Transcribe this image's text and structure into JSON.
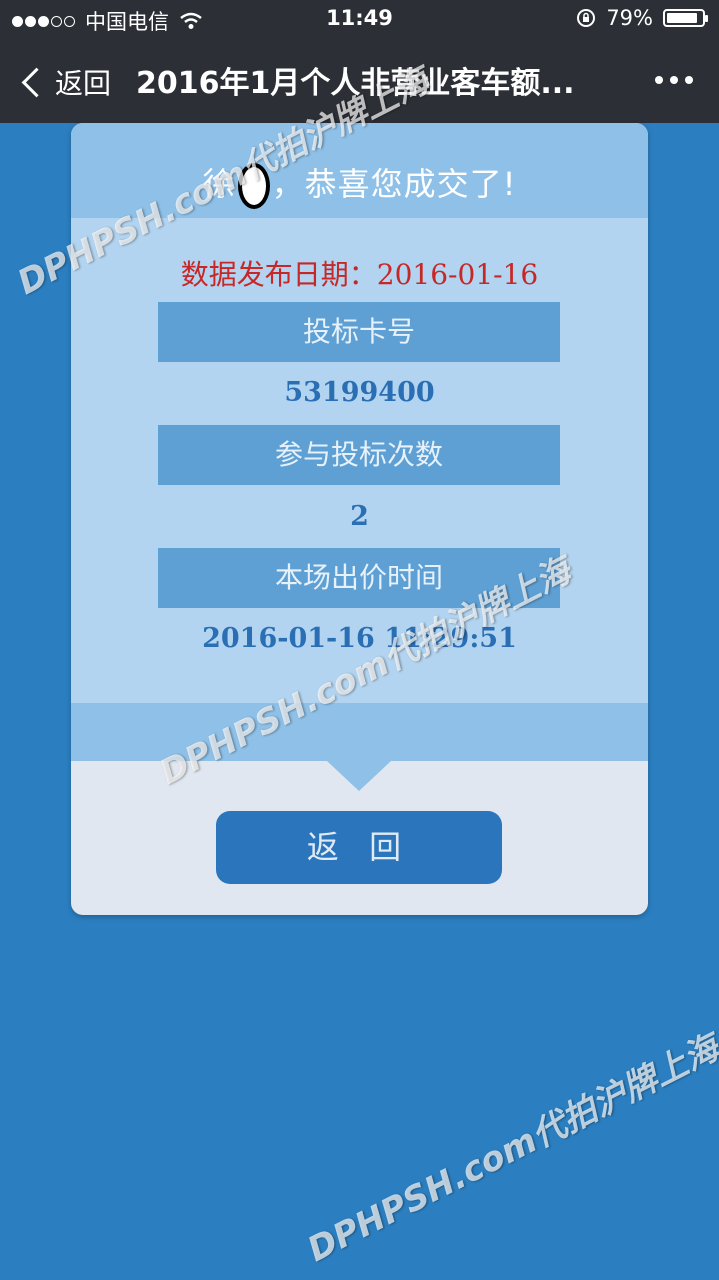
{
  "status_bar": {
    "carrier": "中国电信",
    "time": "11:49",
    "battery": "79%",
    "signal_bars_filled": 3,
    "signal_bars_total": 5
  },
  "nav": {
    "back_label": "返回",
    "title": "2016年1月个人非营业客车额..."
  },
  "card": {
    "greeting_prefix": "徐",
    "greeting_suffix": "，恭喜您成交了!",
    "date_label": "数据发布日期：",
    "date_value": "2016-01-16",
    "fields": [
      {
        "label": "投标卡号",
        "value": "53199400"
      },
      {
        "label": "参与投标次数",
        "value": "2"
      },
      {
        "label": "本场出价时间",
        "value": "2016-01-16 11:29:51"
      }
    ],
    "return_button": "返 回"
  },
  "watermark": {
    "text": "DPHPSH.com代拍沪牌上海"
  },
  "colors": {
    "background": "#2b7fc1",
    "top_bar": "#2c3036",
    "header_blue": "#8ec0e8",
    "body_blue": "#b2d4f0",
    "label_blue": "#5ea0d4",
    "value_blue": "#2a6fb4",
    "date_red": "#c62828",
    "button_blue": "#2b75bc"
  }
}
